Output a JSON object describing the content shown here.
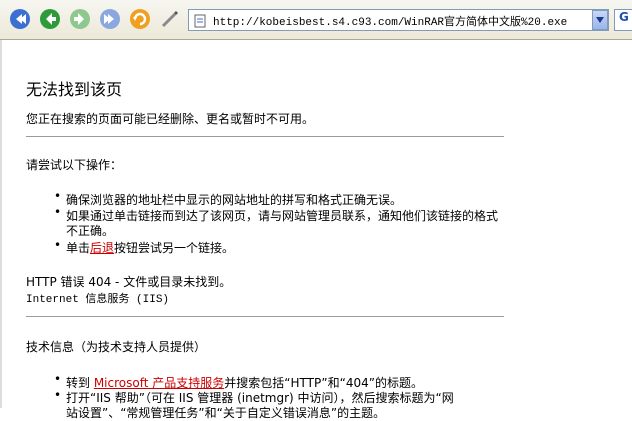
{
  "toolbar": {
    "address": "http://kobeisbest.s4.c93.com/WinRAR官方简体中文版%20.exe",
    "go_label": "G",
    "icons": [
      "back-icon",
      "forward-icon",
      "forward-arrow-icon",
      "next-icon",
      "refresh-icon",
      "edit-icon"
    ]
  },
  "page": {
    "title": "无法找到该页",
    "subtitle": "您正在搜索的页面可能已经删除、更名或暂时不可用。",
    "try_heading": "请尝试以下操作：",
    "tips": [
      "确保浏览器的地址栏中显示的网站地址的拼写和格式正确无误。",
      "如果通过单击链接而到达了该网页，请与网站管理员联系，通知他们该链接的格式",
      "不正确。"
    ],
    "tip3_prefix": "单击",
    "tip3_link": "后退",
    "tip3_suffix": "按钮尝试另一个链接。",
    "error_line1": "HTTP 错误 404 - 文件或目录未找到。",
    "error_line2": "Internet 信息服务 (IIS)",
    "tech_heading": "技术信息（为技术支持人员提供）",
    "tech1_prefix": "转到 ",
    "tech1_link": "Microsoft 产品支持服务",
    "tech1_suffix": "并搜索包括“HTTP”和“404”的标题。",
    "tech2": "打开“IIS 帮助”（可在 IIS 管理器 (inetmgr) 中访问），然后搜索标题为“网",
    "tech2b": "站设置”、“常规管理任务”和“关于自定义错误消息”的主题。"
  },
  "colors": {
    "link": "#cc0000",
    "toolbar": "#ece9d8"
  }
}
